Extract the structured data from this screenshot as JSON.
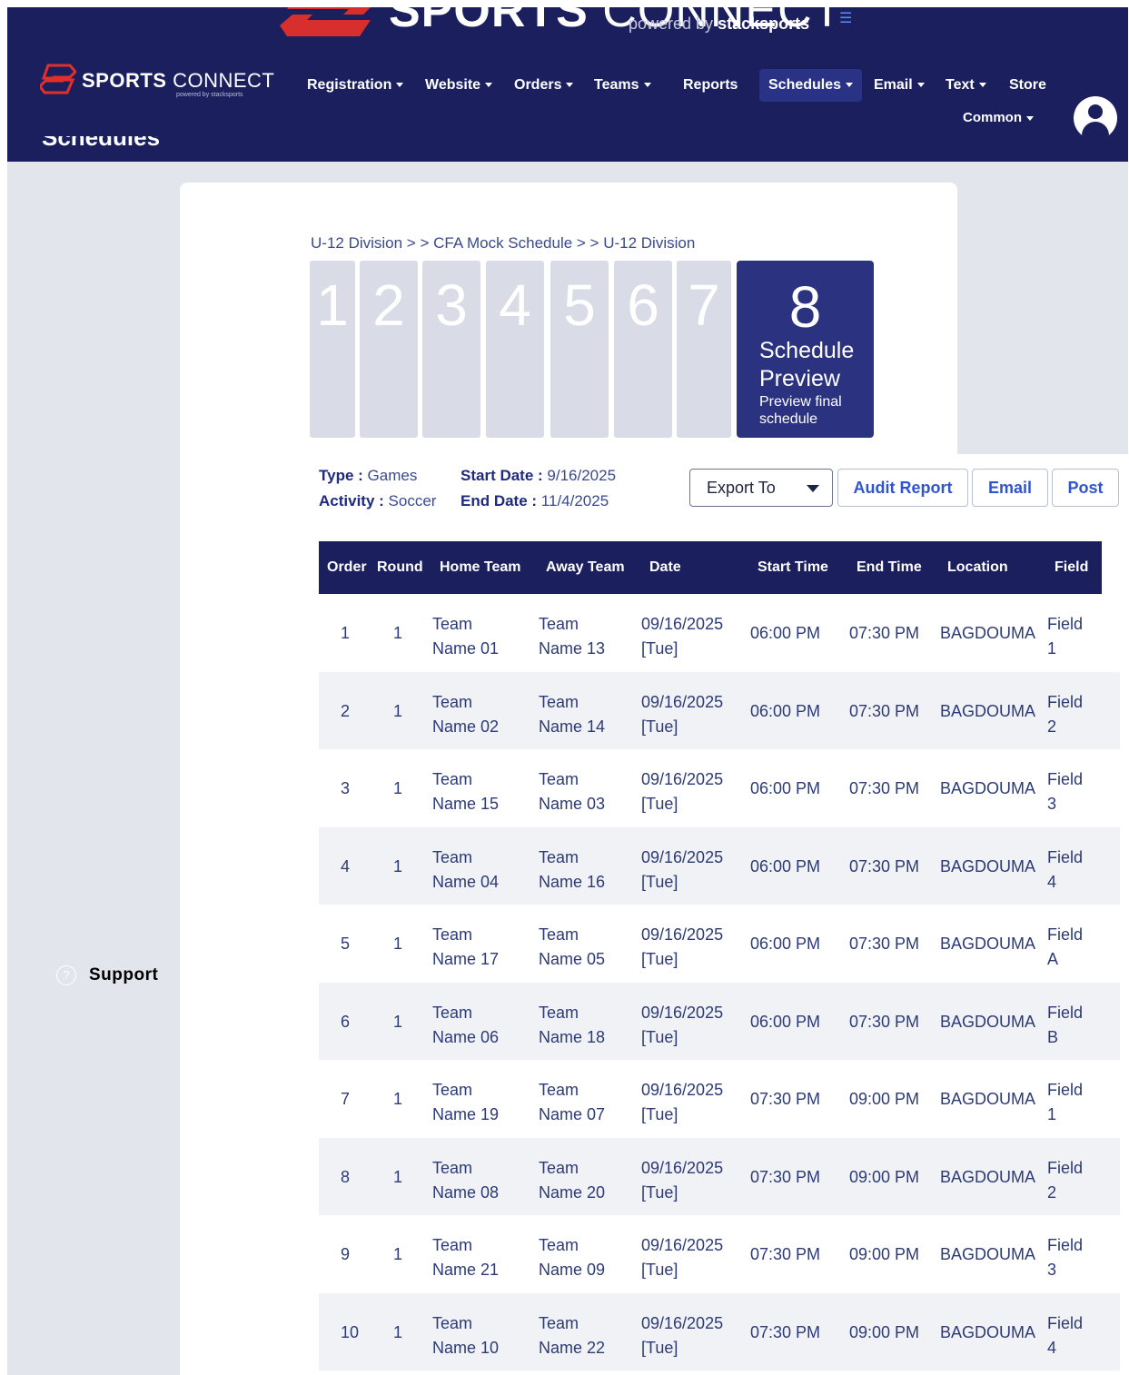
{
  "header": {
    "brand_big": "SPORTS CONNECT",
    "brand_big_bold": "SPORTS",
    "brand_big_thin": "CONNECT",
    "powered_by": "powered by",
    "powered_brand": "stacksports",
    "logo_bold": "SPORTS",
    "logo_thin": "CONNECT",
    "logo_sub": "powered by stacksports",
    "nav": [
      {
        "label": "Registration",
        "has_dropdown": true
      },
      {
        "label": "Website",
        "has_dropdown": true
      },
      {
        "label": "Orders",
        "has_dropdown": true
      },
      {
        "label": "Teams",
        "has_dropdown": true
      },
      {
        "label": "Reports",
        "has_dropdown": false
      },
      {
        "label": "Schedules",
        "has_dropdown": true,
        "active": true
      },
      {
        "label": "Email",
        "has_dropdown": true
      },
      {
        "label": "Text",
        "has_dropdown": true
      },
      {
        "label": "Store",
        "has_dropdown": false
      }
    ],
    "common": "Common",
    "page_title": "Schedules"
  },
  "sidebar": {
    "support": "Support"
  },
  "breadcrumb": "U-12 Division > > CFA Mock Schedule > > U-12 Division",
  "wizard": {
    "steps": [
      "1",
      "2",
      "3",
      "4",
      "5",
      "6",
      "7"
    ],
    "active": {
      "number": "8",
      "title": "Schedule Preview",
      "subtitle": "Preview final schedule"
    }
  },
  "meta": {
    "type_label": "Type :",
    "type_value": "Games",
    "activity_label": "Activity :",
    "activity_value": "Soccer",
    "start_label": "Start Date :",
    "start_value": "9/16/2025",
    "end_label": "End Date :",
    "end_value": "11/4/2025"
  },
  "actions": {
    "export": "Export To",
    "audit": "Audit Report",
    "email": "Email",
    "post": "Post"
  },
  "table": {
    "columns": [
      "Order",
      "Round",
      "Home Team",
      "Away Team",
      "Date",
      "Start Time",
      "End Time",
      "Location",
      "Field"
    ],
    "rows": [
      {
        "order": "1",
        "round": "1",
        "home_1": "Team",
        "home_2": "Name 01",
        "away_1": "Team",
        "away_2": "Name 13",
        "date_1": "09/16/2025",
        "date_2": "[Tue]",
        "start": "06:00 PM",
        "end": "07:30 PM",
        "location": "BAGDOUMA",
        "field_1": "Field",
        "field_2": "1"
      },
      {
        "order": "2",
        "round": "1",
        "home_1": "Team",
        "home_2": "Name 02",
        "away_1": "Team",
        "away_2": "Name 14",
        "date_1": "09/16/2025",
        "date_2": "[Tue]",
        "start": "06:00 PM",
        "end": "07:30 PM",
        "location": "BAGDOUMA",
        "field_1": "Field",
        "field_2": "2"
      },
      {
        "order": "3",
        "round": "1",
        "home_1": "Team",
        "home_2": "Name 15",
        "away_1": "Team",
        "away_2": "Name 03",
        "date_1": "09/16/2025",
        "date_2": "[Tue]",
        "start": "06:00 PM",
        "end": "07:30 PM",
        "location": "BAGDOUMA",
        "field_1": "Field",
        "field_2": "3"
      },
      {
        "order": "4",
        "round": "1",
        "home_1": "Team",
        "home_2": "Name 04",
        "away_1": "Team",
        "away_2": "Name 16",
        "date_1": "09/16/2025",
        "date_2": "[Tue]",
        "start": "06:00 PM",
        "end": "07:30 PM",
        "location": "BAGDOUMA",
        "field_1": "Field",
        "field_2": "4"
      },
      {
        "order": "5",
        "round": "1",
        "home_1": "Team",
        "home_2": "Name 17",
        "away_1": "Team",
        "away_2": "Name 05",
        "date_1": "09/16/2025",
        "date_2": "[Tue]",
        "start": "06:00 PM",
        "end": "07:30 PM",
        "location": "BAGDOUMA",
        "field_1": "Field",
        "field_2": "A"
      },
      {
        "order": "6",
        "round": "1",
        "home_1": "Team",
        "home_2": "Name 06",
        "away_1": "Team",
        "away_2": "Name 18",
        "date_1": "09/16/2025",
        "date_2": "[Tue]",
        "start": "06:00 PM",
        "end": "07:30 PM",
        "location": "BAGDOUMA",
        "field_1": "Field",
        "field_2": "B"
      },
      {
        "order": "7",
        "round": "1",
        "home_1": "Team",
        "home_2": "Name 19",
        "away_1": "Team",
        "away_2": "Name 07",
        "date_1": "09/16/2025",
        "date_2": "[Tue]",
        "start": "07:30 PM",
        "end": "09:00 PM",
        "location": "BAGDOUMA",
        "field_1": "Field",
        "field_2": "1"
      },
      {
        "order": "8",
        "round": "1",
        "home_1": "Team",
        "home_2": "Name 08",
        "away_1": "Team",
        "away_2": "Name 20",
        "date_1": "09/16/2025",
        "date_2": "[Tue]",
        "start": "07:30 PM",
        "end": "09:00 PM",
        "location": "BAGDOUMA",
        "field_1": "Field",
        "field_2": "2"
      },
      {
        "order": "9",
        "round": "1",
        "home_1": "Team",
        "home_2": "Name 21",
        "away_1": "Team",
        "away_2": "Name 09",
        "date_1": "09/16/2025",
        "date_2": "[Tue]",
        "start": "07:30 PM",
        "end": "09:00 PM",
        "location": "BAGDOUMA",
        "field_1": "Field",
        "field_2": "3"
      },
      {
        "order": "10",
        "round": "1",
        "home_1": "Team",
        "home_2": "Name 10",
        "away_1": "Team",
        "away_2": "Name 22",
        "date_1": "09/16/2025",
        "date_2": "[Tue]",
        "start": "07:30 PM",
        "end": "09:00 PM",
        "location": "BAGDOUMA",
        "field_1": "Field",
        "field_2": "4"
      }
    ]
  },
  "colors": {
    "nav_bg": "#1b1f5e",
    "accent_red": "#e0302a",
    "link_blue": "#2f55d4",
    "active_step": "#2b3380"
  }
}
